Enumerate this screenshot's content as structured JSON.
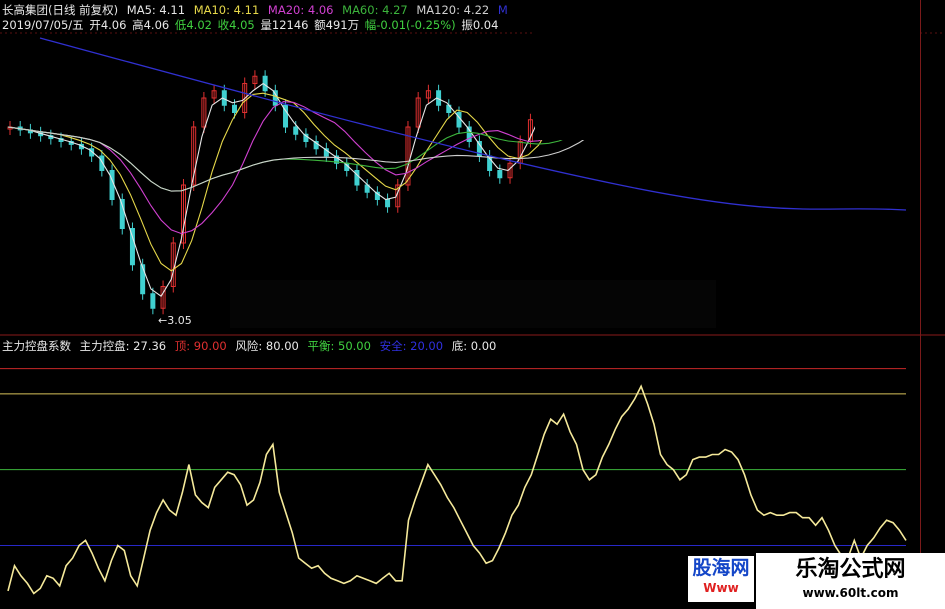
{
  "header": {
    "stock_name": "长高集团(日线 前复权)",
    "ma5": "MA5: 4.11",
    "ma10": "MA10: 4.11",
    "ma20": "MA20: 4.06",
    "ma60": "MA60: 4.27",
    "ma120": "MA120: 4.22",
    "ma_extra": "M",
    "date": "2019/07/05/五",
    "open": "开4.06",
    "high": "高4.06",
    "low": "低4.02",
    "close": "收4.05",
    "volume": "量12146",
    "amount": "额491万",
    "change": "幅-0.01(-0.25%)",
    "amplitude": "振0.04"
  },
  "indicator": {
    "name": "主力控盘系数",
    "value": "主力控盘: 27.36",
    "top": "顶: 90.00",
    "risk": "风险: 80.00",
    "balance": "平衡: 50.00",
    "safe": "安全: 20.00",
    "bottom": "底: 0.00"
  },
  "annotations": {
    "low_marker": "←3.05"
  },
  "watermark": {
    "left_text": "股海网",
    "left_sub": "Www",
    "right_title": "乐淘公式网",
    "right_url": "www.60lt.com"
  },
  "colors": {
    "ma5": "#e6e6e6",
    "ma10": "#e6d84a",
    "ma20": "#d040d0",
    "ma60": "#3cb43c",
    "ma120": "#cfcfcf",
    "ma_long": "#3030d0",
    "up": "#e03030",
    "down": "#40d0d0",
    "ind_line": "#f5e99a",
    "top_line": "#c82828",
    "risk_line": "#d8c25a",
    "balance_line": "#3cb43c",
    "safe_line": "#2828c8"
  },
  "chart_data": {
    "type": "line",
    "levels": {
      "top": 90,
      "risk": 80,
      "balance": 50,
      "safe": 20,
      "bottom": 0
    },
    "ylim": [
      0,
      95
    ],
    "series": [
      {
        "name": "主力控盘",
        "values": [
          2,
          12,
          8,
          5,
          1,
          3,
          8,
          7,
          4,
          12,
          15,
          20,
          22,
          17,
          11,
          6,
          14,
          20,
          18,
          8,
          4,
          15,
          26,
          33,
          38,
          34,
          32,
          41,
          52,
          40,
          37,
          35,
          43,
          46,
          49,
          48,
          44,
          36,
          38,
          45,
          56,
          60,
          41,
          33,
          25,
          15,
          13,
          11,
          12,
          9,
          7,
          6,
          5,
          6,
          8,
          7,
          6,
          5,
          7,
          9,
          6,
          6,
          30,
          38,
          45,
          52,
          48,
          44,
          39,
          35,
          30,
          25,
          20,
          17,
          13,
          14,
          19,
          25,
          32,
          36,
          43,
          48,
          56,
          64,
          70,
          68,
          72,
          65,
          60,
          50,
          46,
          48,
          55,
          60,
          66,
          71,
          74,
          78,
          83,
          76,
          68,
          56,
          52,
          50,
          46,
          48,
          54,
          55,
          55,
          56,
          56,
          58,
          57,
          54,
          48,
          40,
          34,
          32,
          33,
          32,
          32,
          33,
          33,
          31,
          31,
          28,
          31,
          26,
          20,
          16,
          15,
          22,
          15,
          20,
          23,
          27,
          30,
          29,
          26,
          22
        ]
      }
    ]
  }
}
